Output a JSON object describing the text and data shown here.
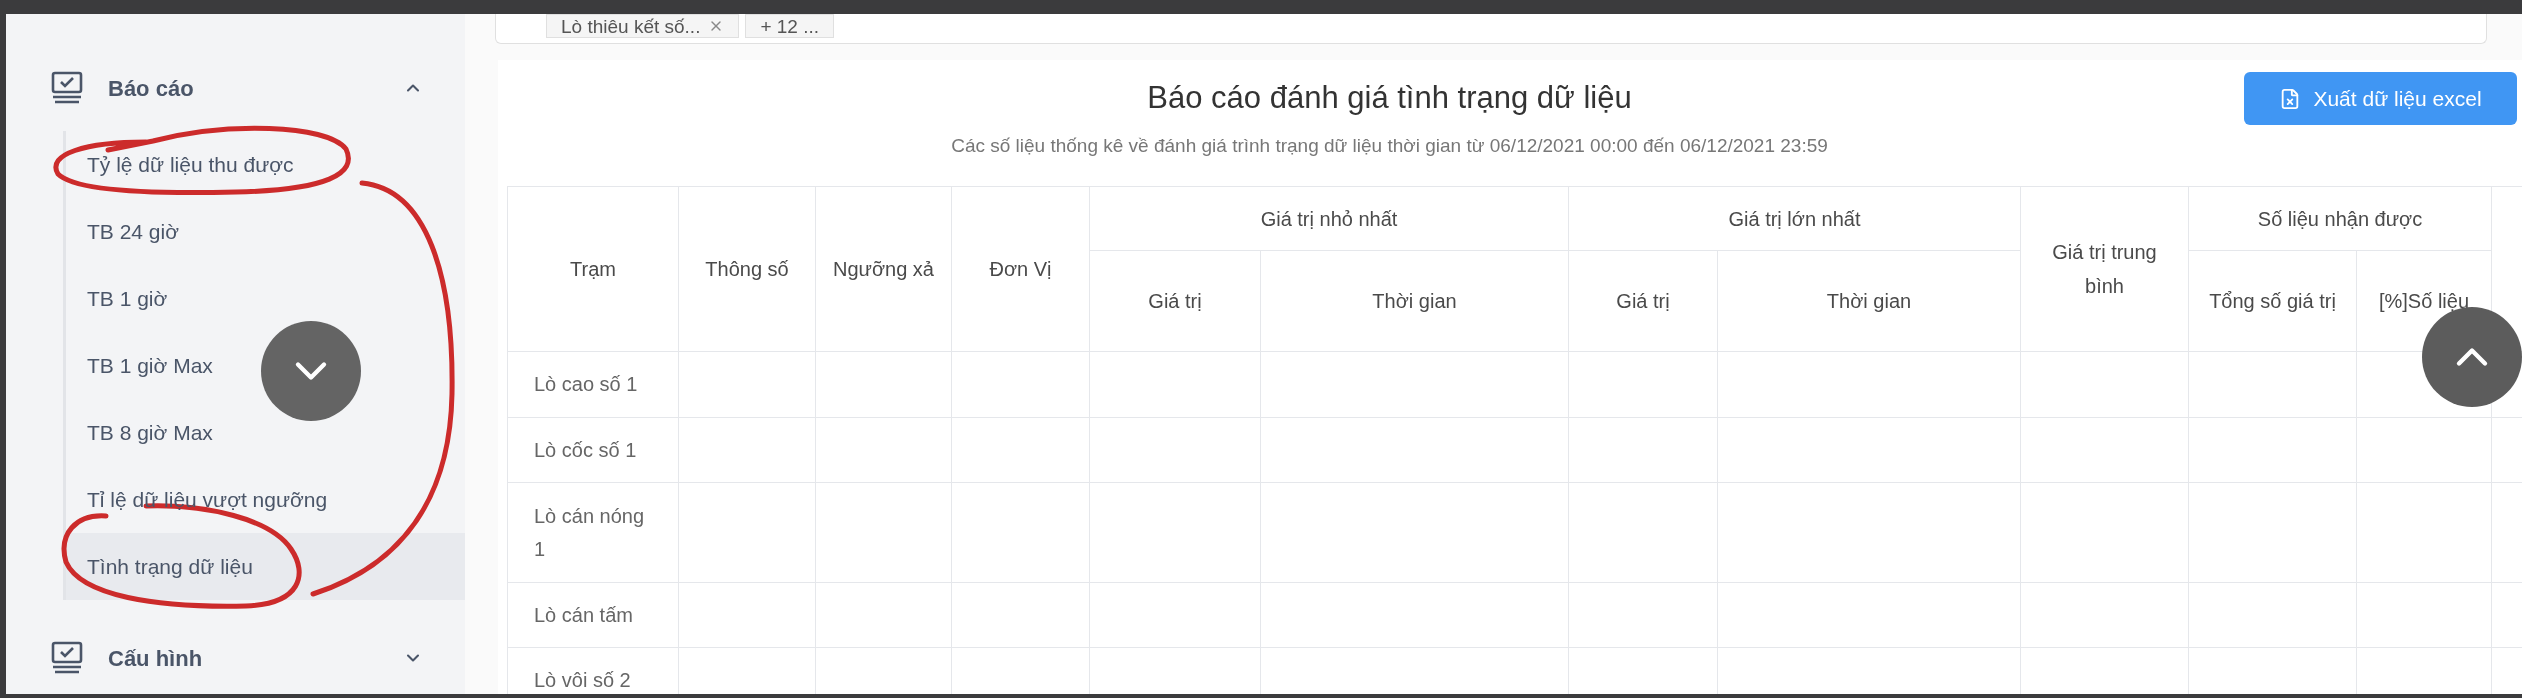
{
  "sidebar": {
    "groups": [
      {
        "label": "Báo cáo",
        "expanded": true,
        "items": [
          {
            "label": "Tỷ lệ dữ liệu thu được",
            "selected": false
          },
          {
            "label": "TB 24 giờ",
            "selected": false
          },
          {
            "label": "TB 1 giờ",
            "selected": false
          },
          {
            "label": "TB 1 giờ Max",
            "selected": false
          },
          {
            "label": "TB 8 giờ Max",
            "selected": false
          },
          {
            "label": "Tỉ lệ dữ liệu vượt ngưỡng",
            "selected": false
          },
          {
            "label": "Tình trạng dữ liệu",
            "selected": true
          }
        ]
      },
      {
        "label": "Cấu hình",
        "expanded": false
      }
    ]
  },
  "filter": {
    "tags": [
      {
        "label": "Lò thiêu kết số...",
        "removable": true
      },
      {
        "label": "+ 12 ...",
        "removable": false
      }
    ]
  },
  "report": {
    "title": "Báo cáo đánh giá tình trạng dữ liệu",
    "subtitle": "Các số liệu thống kê về đánh giá trình trạng dữ liệu thời gian từ 06/12/2021 00:00 đến 06/12/2021 23:59",
    "export_button": "Xuất dữ liệu excel",
    "table": {
      "columns": [
        {
          "label": "Trạm"
        },
        {
          "label": "Thông số"
        },
        {
          "label": "Ngưỡng xả"
        },
        {
          "label": "Đơn Vị"
        },
        {
          "label": "Giá trị nhỏ nhất",
          "children": [
            {
              "label": "Giá trị"
            },
            {
              "label": "Thời gian"
            }
          ]
        },
        {
          "label": "Giá trị lớn nhất",
          "children": [
            {
              "label": "Giá trị"
            },
            {
              "label": "Thời gian"
            }
          ]
        },
        {
          "label": "Giá trị trung bình"
        },
        {
          "label": "Số liệu nhận được",
          "children": [
            {
              "label": "Tổng số giá trị"
            },
            {
              "label": "[%]Số liệu"
            }
          ]
        }
      ],
      "rows": [
        {
          "station": "Lò cao số 1"
        },
        {
          "station": "Lò cốc số 1"
        },
        {
          "station": "Lò cán nóng 1"
        },
        {
          "station": "Lò cán tấm"
        },
        {
          "station": "Lò vôi số 2"
        }
      ]
    }
  }
}
